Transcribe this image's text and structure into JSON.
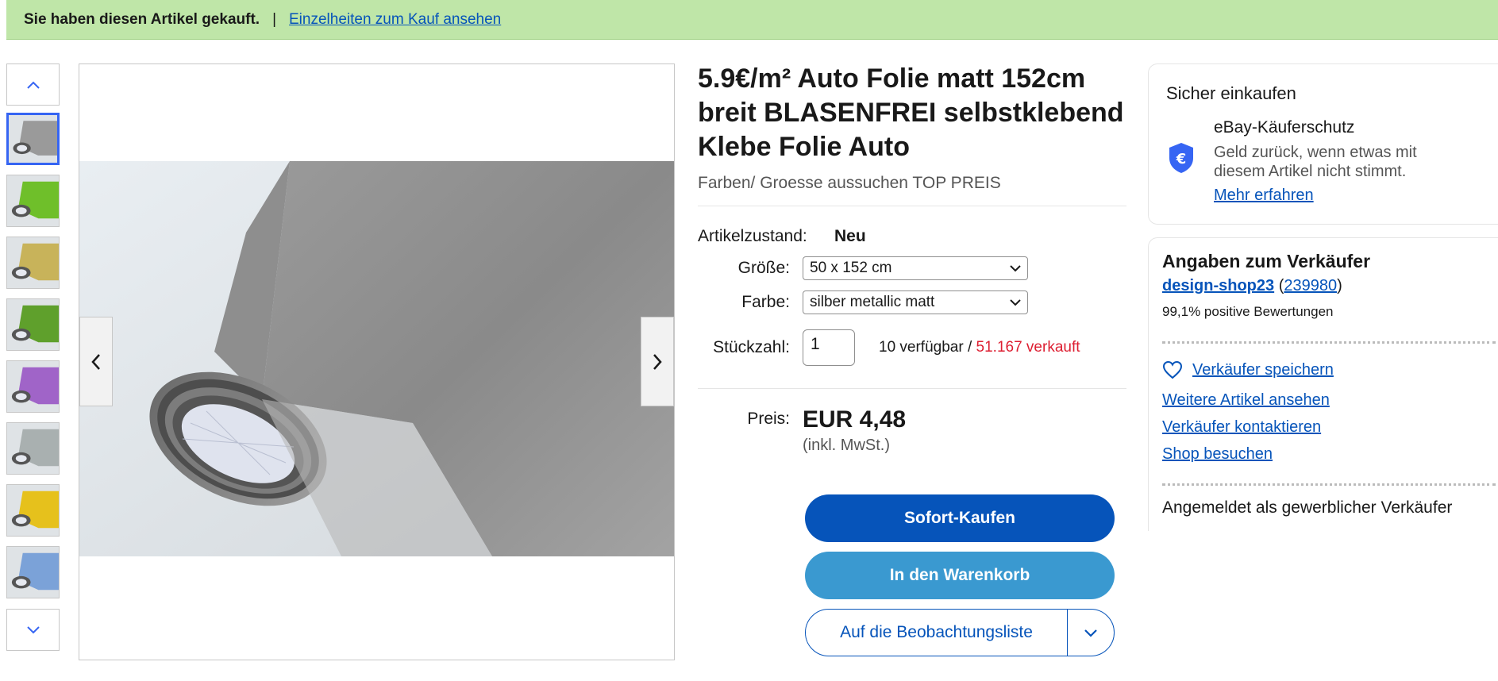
{
  "banner": {
    "text": "Sie haben diesen Artikel gekauft.",
    "separator": "|",
    "link": "Einzelheiten zum Kauf ansehen"
  },
  "gallery": {
    "thumbnails": [
      {
        "color": "#9a9a9a",
        "name": "silver-matte"
      },
      {
        "color": "#6fbf2a",
        "name": "green"
      },
      {
        "color": "#c8b35a",
        "name": "gold"
      },
      {
        "color": "#5fa02c",
        "name": "olive-green"
      },
      {
        "color": "#a064c8",
        "name": "purple"
      },
      {
        "color": "#a9b0b0",
        "name": "silver"
      },
      {
        "color": "#e6c11c",
        "name": "yellow"
      },
      {
        "color": "#7ba2d8",
        "name": "blue"
      }
    ],
    "active_index": 0
  },
  "product": {
    "title": "5.9€/m² Auto Folie matt 152cm breit BLASENFREI selbstklebend Klebe Folie Auto",
    "subtitle": "Farben/ Groesse aussuchen TOP PREIS",
    "condition_label": "Artikelzustand:",
    "condition_value": "Neu",
    "size_label": "Größe:",
    "size_value": "50 x 152 cm",
    "color_label": "Farbe:",
    "color_value": "silber metallic matt",
    "qty_label": "Stückzahl:",
    "qty_value": "1",
    "available": "10 verfügbar /",
    "sold": "51.167 verkauft",
    "price_label": "Preis:",
    "price": "EUR 4,48",
    "tax_note": "(inkl. MwSt.)",
    "buy_now": "Sofort-Kaufen",
    "add_to_cart": "In den Warenkorb",
    "watchlist": "Auf die Beobachtungsliste"
  },
  "secure": {
    "title": "Sicher einkaufen",
    "protection_title": "eBay-Käuferschutz",
    "protection_desc": "Geld zurück, wenn etwas mit diesem Artikel nicht stimmt.",
    "learn_more": "Mehr erfahren",
    "icon": "euro-shield-icon"
  },
  "seller": {
    "title": "Angaben zum Verkäufer",
    "name": "design-shop23",
    "score_open": "(",
    "score": "239980",
    "score_close": ")",
    "rating": "99,1% positive Bewertungen",
    "save": "Verkäufer speichern",
    "more_items": "Weitere Artikel ansehen",
    "contact": "Verkäufer kontaktieren",
    "visit_shop": "Shop besuchen",
    "note": "Angemeldet als gewerblicher Verkäufer"
  },
  "colors": {
    "banner_bg": "#bfe6a8",
    "link": "#0654ba",
    "buy_button": "#0654ba",
    "cart_button": "#3a99d0",
    "sold_red": "#dd1e31",
    "active_thumb": "#3665f3"
  }
}
